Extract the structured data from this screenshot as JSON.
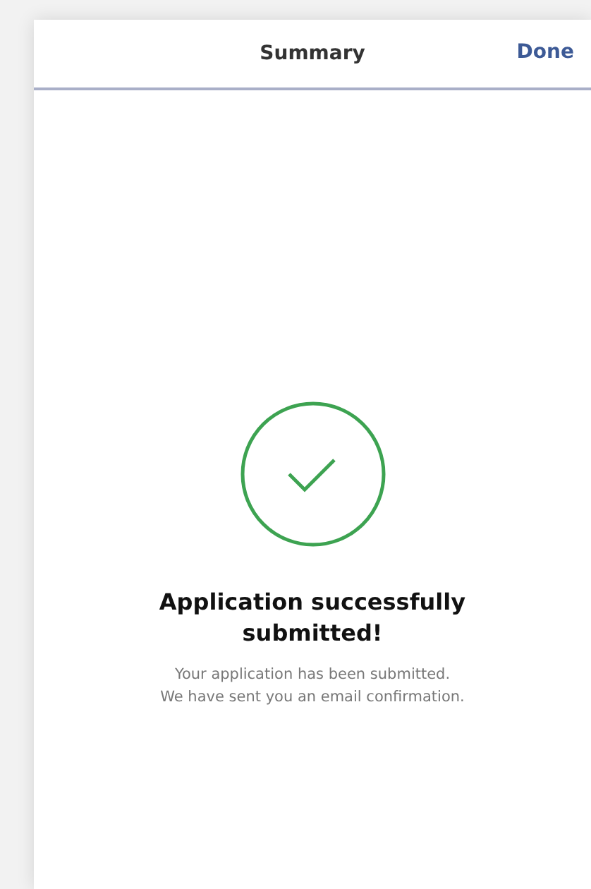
{
  "header": {
    "title": "Summary",
    "action": "Done"
  },
  "message": {
    "title": "Application successfully submitted!",
    "lines": [
      "Your application has been submitted.",
      "We have sent you an email confirmation."
    ]
  }
}
